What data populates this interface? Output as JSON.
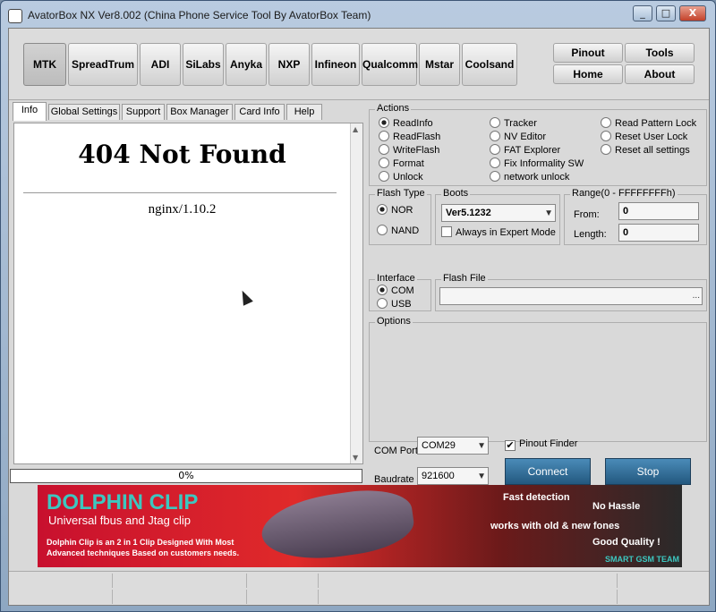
{
  "window": {
    "title": "AvatorBox NX Ver8.002 (China Phone Service Tool By AvatorBox Team)",
    "controls": {
      "minimize": "_",
      "maximize": "□",
      "close": "X"
    }
  },
  "vendors": [
    "MTK",
    "SpreadTrum",
    "ADI",
    "SiLabs",
    "Anyka",
    "NXP",
    "Infineon",
    "Qualcomm",
    "Mstar",
    "Coolsand"
  ],
  "active_vendor": "MTK",
  "side_buttons": {
    "pinout": "Pinout",
    "tools": "Tools",
    "home": "Home",
    "about": "About"
  },
  "tabs": [
    "Info",
    "Global Settings",
    "Support",
    "Box Manager",
    "Card Info",
    "Help"
  ],
  "active_tab": "Info",
  "browser": {
    "heading": "404 Not Found",
    "server": "nginx/1.10.2"
  },
  "progress": {
    "label": "0%",
    "value": 0
  },
  "actions": {
    "title": "Actions",
    "col1": [
      "ReadInfo",
      "ReadFlash",
      "WriteFlash",
      "Format",
      "Unlock"
    ],
    "col2": [
      "Tracker",
      "NV Editor",
      "FAT Explorer",
      "Fix Informality SW",
      "network unlock"
    ],
    "col3": [
      "Read Pattern Lock",
      "Reset User Lock",
      "Reset all settings"
    ],
    "selected": "ReadInfo"
  },
  "flash_type": {
    "title": "Flash Type",
    "options": [
      "NOR",
      "NAND"
    ],
    "selected": "NOR"
  },
  "boots": {
    "title": "Boots",
    "value": "Ver5.1232",
    "expert_label": "Always in Expert Mode",
    "expert_checked": false
  },
  "range": {
    "title": "Range(0 - FFFFFFFFh)",
    "from_label": "From:",
    "from_value": "0",
    "length_label": "Length:",
    "length_value": "0"
  },
  "interface": {
    "title": "Interface",
    "options": [
      "COM",
      "USB"
    ],
    "selected": "COM"
  },
  "flash_file": {
    "title": "Flash File",
    "value": "",
    "browse": "..."
  },
  "options": {
    "title": "Options"
  },
  "connection": {
    "com_port_label": "COM Port",
    "com_port_value": "COM29",
    "baudrate_label": "Baudrate",
    "baudrate_value": "921600",
    "pinout_finder_label": "Pinout Finder",
    "pinout_finder_checked": true,
    "connect_label": "Connect",
    "stop_label": "Stop"
  },
  "banner": {
    "title": "DOLPHIN CLIP",
    "subtitle": "Universal fbus and Jtag clip",
    "description": "Dolphin Clip is an 2 in 1 Clip Designed With Most Advanced techniques Based on customers needs.",
    "right": [
      "Fast detection",
      "No Hassle",
      "works with old & new fones",
      "Good Quality !",
      "SMART GSM TEAM"
    ]
  },
  "colors": {
    "accent_button": "#2f6b96",
    "banner_red": "#c8102e",
    "banner_teal": "#3cc7c0"
  }
}
